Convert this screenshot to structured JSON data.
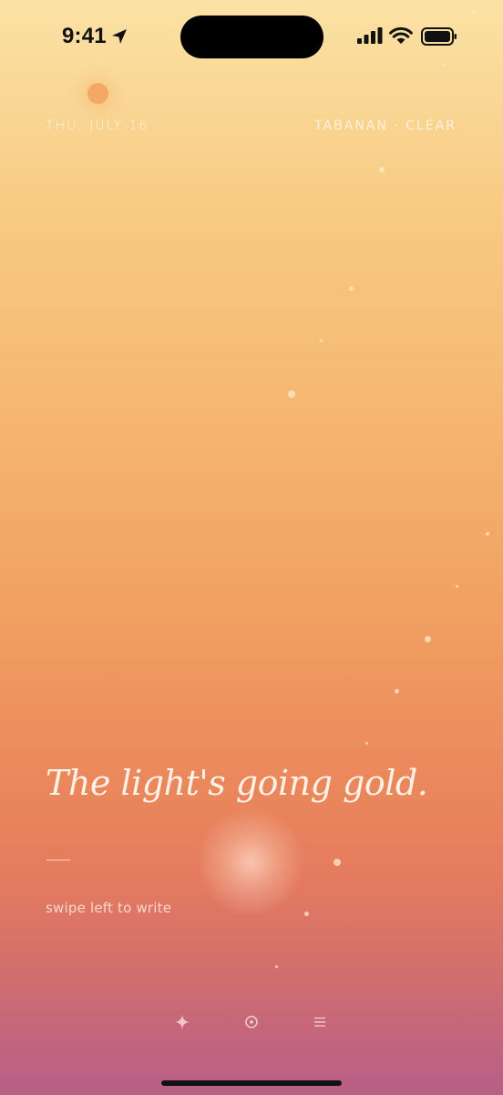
{
  "status_bar": {
    "time": "9:41",
    "icons": [
      "location-arrow-icon",
      "cellular-signal-icon",
      "wifi-icon",
      "battery-icon"
    ]
  },
  "header": {
    "date": "THU, JULY 16",
    "location_weather": "TABANAN · CLEAR"
  },
  "main": {
    "headline": "The light's going gold.",
    "hint": "swipe left to write"
  },
  "bottom_nav": {
    "items": [
      {
        "icon": "sparkle-icon"
      },
      {
        "icon": "target-icon"
      },
      {
        "icon": "menu-icon"
      }
    ]
  },
  "colors": {
    "gradient_top": "#fbe2a5",
    "gradient_mid": "#f1a062",
    "gradient_bottom": "#b85f86",
    "text_light": "#fff8ee"
  }
}
